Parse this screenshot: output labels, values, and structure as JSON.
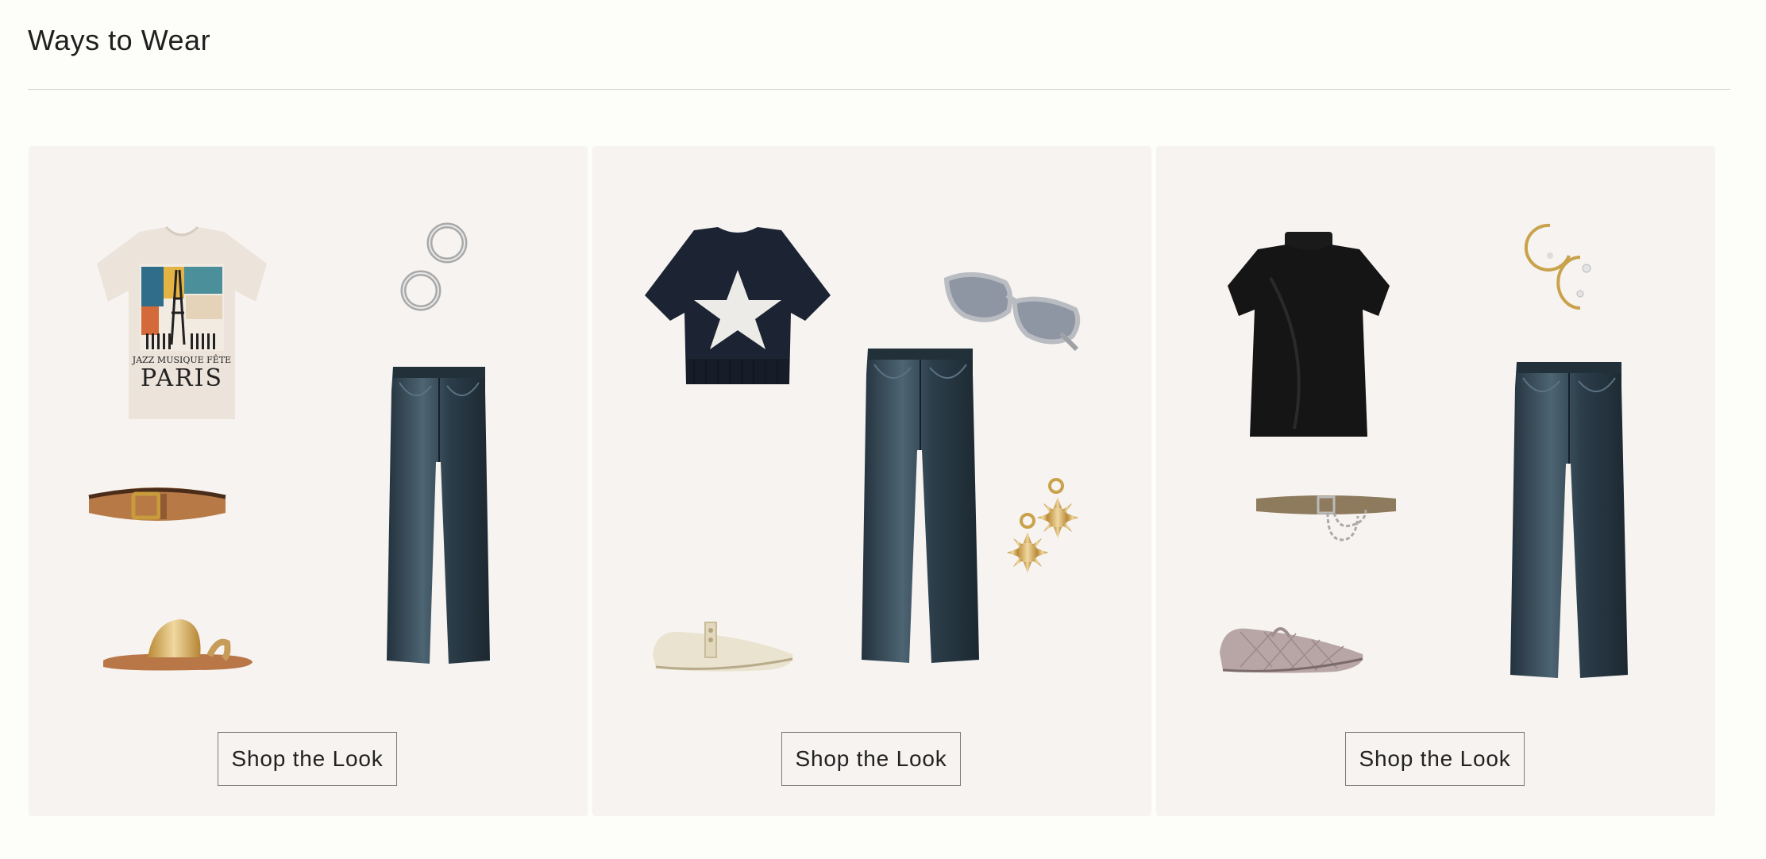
{
  "section": {
    "title": "Ways to Wear"
  },
  "looks": [
    {
      "items": [
        "graphic-tee-icon",
        "hoop-earrings-icon",
        "leather-belt-icon",
        "flare-jeans-icon",
        "metallic-sandal-icon"
      ],
      "tee_print": [
        "JAZZ MUSIQUE FÊTE",
        "PARIS"
      ],
      "button_label": "Shop the Look"
    },
    {
      "items": [
        "star-sweater-icon",
        "sunglasses-icon",
        "flare-jeans-icon",
        "sun-earrings-icon",
        "mary-jane-flat-icon"
      ],
      "button_label": "Shop the Look"
    },
    {
      "items": [
        "black-mock-neck-top-icon",
        "gold-hoop-earrings-icon",
        "chain-belt-icon",
        "flare-jeans-icon",
        "quilted-flat-icon"
      ],
      "button_label": "Shop the Look"
    }
  ],
  "colors": {
    "page_bg": "#fdfdf9",
    "card_bg": "#f6f3f1",
    "denim": "#2f4350",
    "navy_sweater": "#1c2433",
    "gold": "#c9a24b",
    "silver": "#9b9b9b"
  }
}
